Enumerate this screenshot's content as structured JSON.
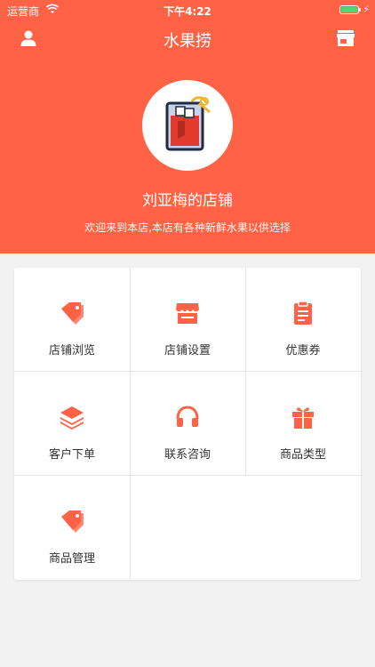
{
  "status": {
    "carrier": "运营商",
    "time": "下午4:22"
  },
  "nav": {
    "title": "水果捞"
  },
  "shop": {
    "name": "刘亚梅的店铺",
    "description": "欢迎来到本店,本店有各种新鲜水果以供选择"
  },
  "menu": [
    {
      "label": "店铺浏览",
      "icon": "tag-icon"
    },
    {
      "label": "店铺设置",
      "icon": "storefront-icon"
    },
    {
      "label": "优惠券",
      "icon": "clipboard-icon"
    },
    {
      "label": "客户下单",
      "icon": "layers-icon"
    },
    {
      "label": "联系咨询",
      "icon": "headphones-icon"
    },
    {
      "label": "商品类型",
      "icon": "gift-icon"
    },
    {
      "label": "商品管理",
      "icon": "tag-icon"
    }
  ],
  "colors": {
    "accent": "#ff6244",
    "battery": "#51d96c"
  }
}
